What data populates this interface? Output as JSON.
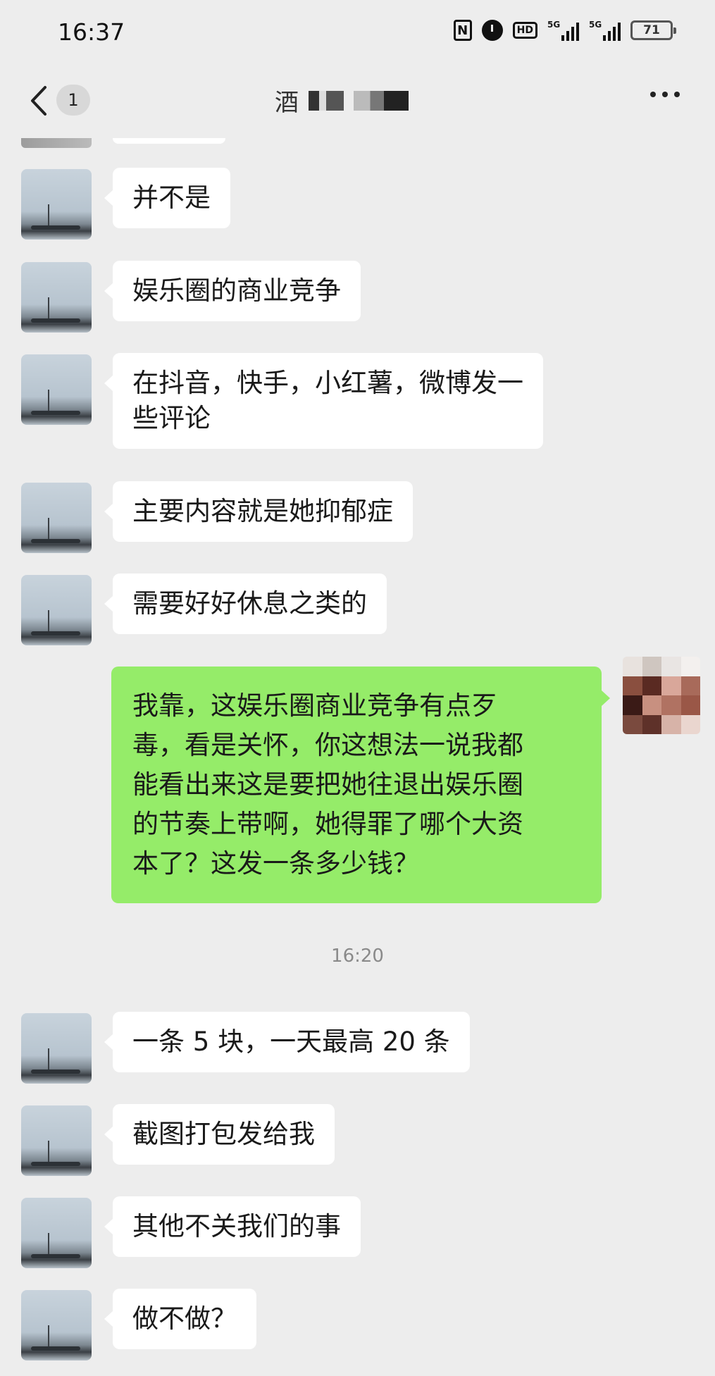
{
  "status_bar": {
    "time": "16:37",
    "hd_label": "HD",
    "sim1_label": "5G",
    "sim2_label": "5G",
    "battery": "71"
  },
  "nav": {
    "back_icon": "chevron-left-icon",
    "unread_count": "1",
    "title_visible": "酒",
    "more_icon": "more-dots-icon"
  },
  "messages": [
    {
      "side": "in",
      "text": "并不是"
    },
    {
      "side": "in",
      "text": "娱乐圈的商业竞争"
    },
    {
      "side": "in",
      "line1": "在抖音，快手，小红薯，微博发一",
      "line2": "些评论"
    },
    {
      "side": "in",
      "text": "主要内容就是她抑郁症"
    },
    {
      "side": "in",
      "text": "需要好好休息之类的"
    },
    {
      "side": "out",
      "lines": [
        "我靠，这娱乐圈商业竞争有点歹",
        "毒，看是关怀，你这想法一说我都",
        "能看出来这是要把她往退出娱乐圈",
        "的节奏上带啊，她得罪了哪个大资",
        "本了？这发一条多少钱？"
      ]
    },
    {
      "side": "in",
      "text": "一条 5 块，一天最高 20 条"
    },
    {
      "side": "in",
      "text": "截图打包发给我"
    },
    {
      "side": "in",
      "text": "其他不关我们的事"
    },
    {
      "side": "in",
      "text": "做不做？"
    }
  ],
  "timestamp": "16:20",
  "colors": {
    "background": "#ededed",
    "incoming_bubble": "#ffffff",
    "outgoing_bubble": "#95ec69",
    "timestamp_text": "#8a8a8a"
  }
}
